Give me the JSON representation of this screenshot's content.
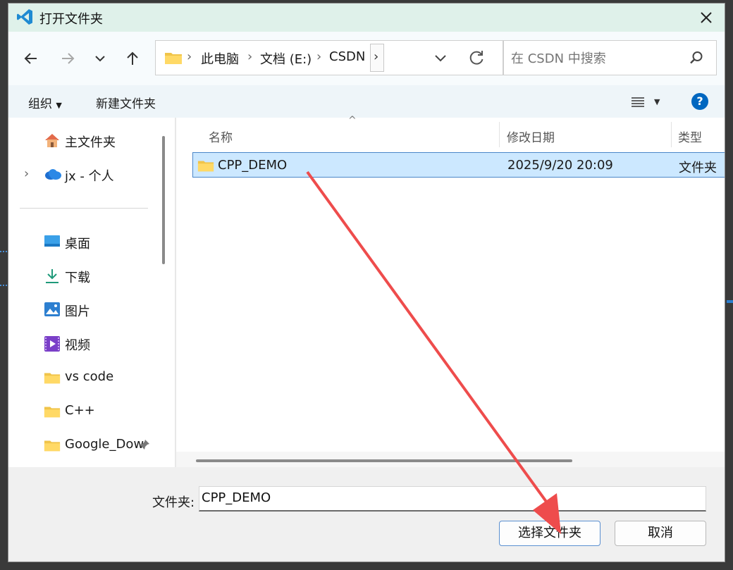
{
  "dialog": {
    "title": "打开文件夹"
  },
  "address": {
    "crumbs": [
      "此电脑",
      "文档 (E:)",
      "CSDN"
    ]
  },
  "search": {
    "placeholder": "在 CSDN 中搜索"
  },
  "commandbar": {
    "organize": "组织",
    "new_folder": "新建文件夹"
  },
  "sidebar": {
    "items": [
      {
        "label": "主文件夹",
        "icon": "home-icon"
      },
      {
        "label": "jx - 个人",
        "icon": "onedrive-cloud-icon"
      },
      {
        "label": "桌面",
        "icon": "desktop-icon"
      },
      {
        "label": "下载",
        "icon": "download-icon"
      },
      {
        "label": "图片",
        "icon": "pictures-icon"
      },
      {
        "label": "视频",
        "icon": "videos-icon"
      },
      {
        "label": "vs code",
        "icon": "folder-icon"
      },
      {
        "label": "C++",
        "icon": "folder-icon"
      },
      {
        "label": "Google_Dow",
        "icon": "folder-icon"
      }
    ]
  },
  "columns": {
    "name": "名称",
    "date": "修改日期",
    "type": "类型"
  },
  "files": [
    {
      "name": "CPP_DEMO",
      "date": "2025/9/20 20:09",
      "type": "文件夹"
    }
  ],
  "footer": {
    "folder_label": "文件夹:",
    "folder_value": "CPP_DEMO",
    "select_button": "选择文件夹",
    "cancel_button": "取消"
  },
  "colors": {
    "accent": "#0067c0",
    "selection": "#cce8ff",
    "annotation_arrow": "#ee4c4c",
    "titlebar": "#dff1ea"
  }
}
